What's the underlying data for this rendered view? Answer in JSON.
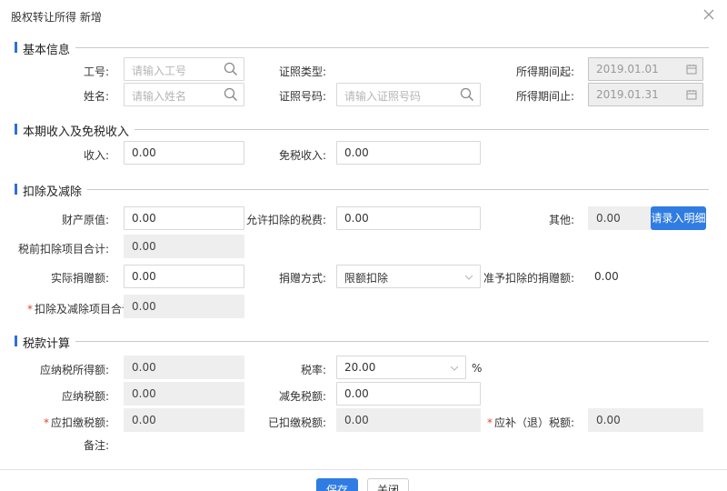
{
  "dialog": {
    "title": "股权转让所得 新增"
  },
  "sections": {
    "basic": "基本信息",
    "income": "本期收入及免税收入",
    "deduction": "扣除及减除",
    "tax": "税款计算"
  },
  "basic": {
    "employee_no_label": "工号:",
    "employee_no_placeholder": "请输入工号",
    "name_label": "姓名:",
    "name_placeholder": "请输入姓名",
    "id_type_label": "证照类型:",
    "id_no_label": "证照号码:",
    "id_no_placeholder": "请输入证照号码",
    "period_start_label": "所得期间起:",
    "period_start_value": "2019.01.01",
    "period_end_label": "所得期间止:",
    "period_end_value": "2019.01.31"
  },
  "income": {
    "income_label": "收入:",
    "income_value": "0.00",
    "exempt_label": "免税收入:",
    "exempt_value": "0.00"
  },
  "deduction": {
    "original_value_label": "财产原值:",
    "original_value": "0.00",
    "allowed_tax_label": "允许扣除的税费:",
    "allowed_tax_value": "0.00",
    "other_label": "其他:",
    "other_value": "0.00",
    "detail_button": "请录入明细",
    "pretax_total_label": "税前扣除项目合计:",
    "pretax_total_value": "0.00",
    "donation_label": "实际捐赠额:",
    "donation_value": "0.00",
    "donation_method_label": "捐赠方式:",
    "donation_method_value": "限额扣除",
    "allowed_donation_label": "准予扣除的捐赠额:",
    "allowed_donation_value": "0.00",
    "deduction_total_label": "扣除及减除项目合计:",
    "deduction_total_value": "0.00"
  },
  "tax": {
    "taxable_income_label": "应纳税所得额:",
    "taxable_income_value": "0.00",
    "rate_label": "税率:",
    "rate_value": "20.00",
    "rate_unit": "%",
    "tax_payable_label": "应纳税额:",
    "tax_payable_value": "0.00",
    "tax_reduction_label": "减免税额:",
    "tax_reduction_value": "0.00",
    "tax_due_label": "应扣缴税额:",
    "tax_due_value": "0.00",
    "tax_withheld_label": "已扣缴税额:",
    "tax_withheld_value": "0.00",
    "tax_refund_label": "应补（退）税额:",
    "tax_refund_value": "0.00",
    "remark_label": "备注:"
  },
  "footer": {
    "save_button": "保存",
    "close_button": "关闭"
  },
  "colors": {
    "accent": "#2f7ce3",
    "section_bar": "#2f6fd6",
    "required": "#e0482b"
  }
}
